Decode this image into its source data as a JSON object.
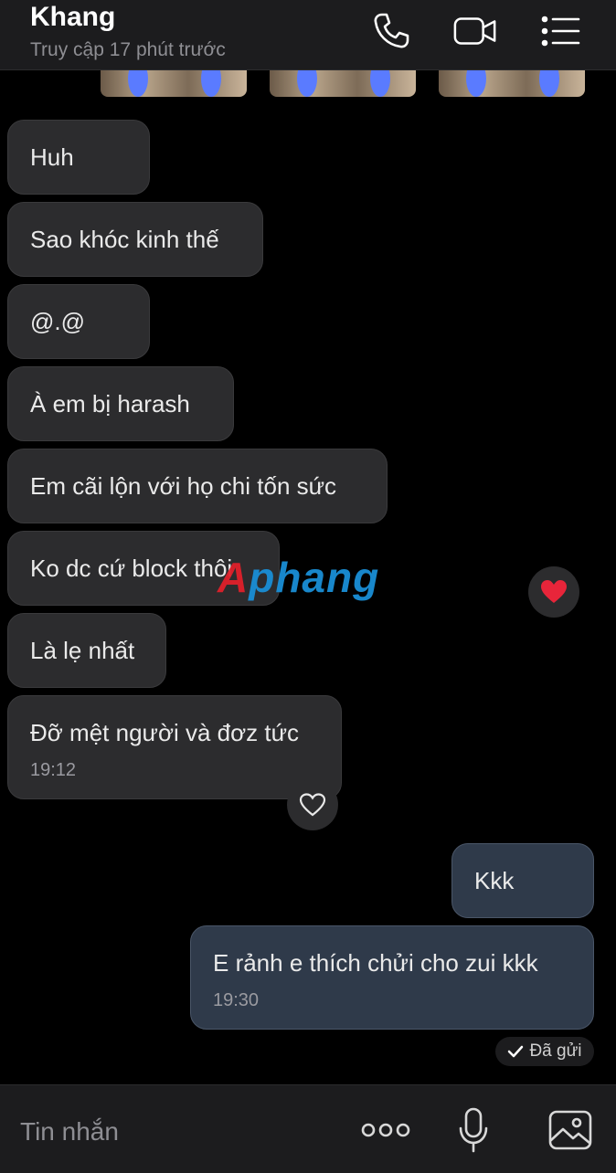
{
  "header": {
    "contact_name": "Khang",
    "last_seen": "Truy cập 17 phút trước",
    "icons": [
      "phone-icon",
      "video-call-icon",
      "menu-list-icon"
    ]
  },
  "messages": [
    {
      "direction": "incoming",
      "text": "Huh"
    },
    {
      "direction": "incoming",
      "text": "Sao khóc kinh thế"
    },
    {
      "direction": "incoming",
      "text": "@.@"
    },
    {
      "direction": "incoming",
      "text": "À em bị harash"
    },
    {
      "direction": "incoming",
      "text": "Em cãi lộn với họ chi tốn sức"
    },
    {
      "direction": "incoming",
      "text": "Ko dc cứ block thôi"
    },
    {
      "direction": "incoming",
      "text": "Là lẹ nhất"
    },
    {
      "direction": "incoming",
      "text": "Đỡ mệt người và đơz tức",
      "time": "19:12"
    },
    {
      "direction": "outgoing",
      "text": "Kkk"
    },
    {
      "direction": "outgoing",
      "text": "E rảnh e thích chửi cho zui kkk",
      "time": "19:30"
    }
  ],
  "reactions": {
    "filled": "red-heart",
    "empty": "heart-outline"
  },
  "status": {
    "sent_label": "Đã gửi"
  },
  "watermark": {
    "part1": "A",
    "part2": "phang"
  },
  "input": {
    "placeholder": "Tin nhắn"
  },
  "colors": {
    "background": "#000000",
    "incoming_bubble": "#2c2c2e",
    "outgoing_bubble": "#2f3a4a",
    "heart": "#e8253a"
  }
}
